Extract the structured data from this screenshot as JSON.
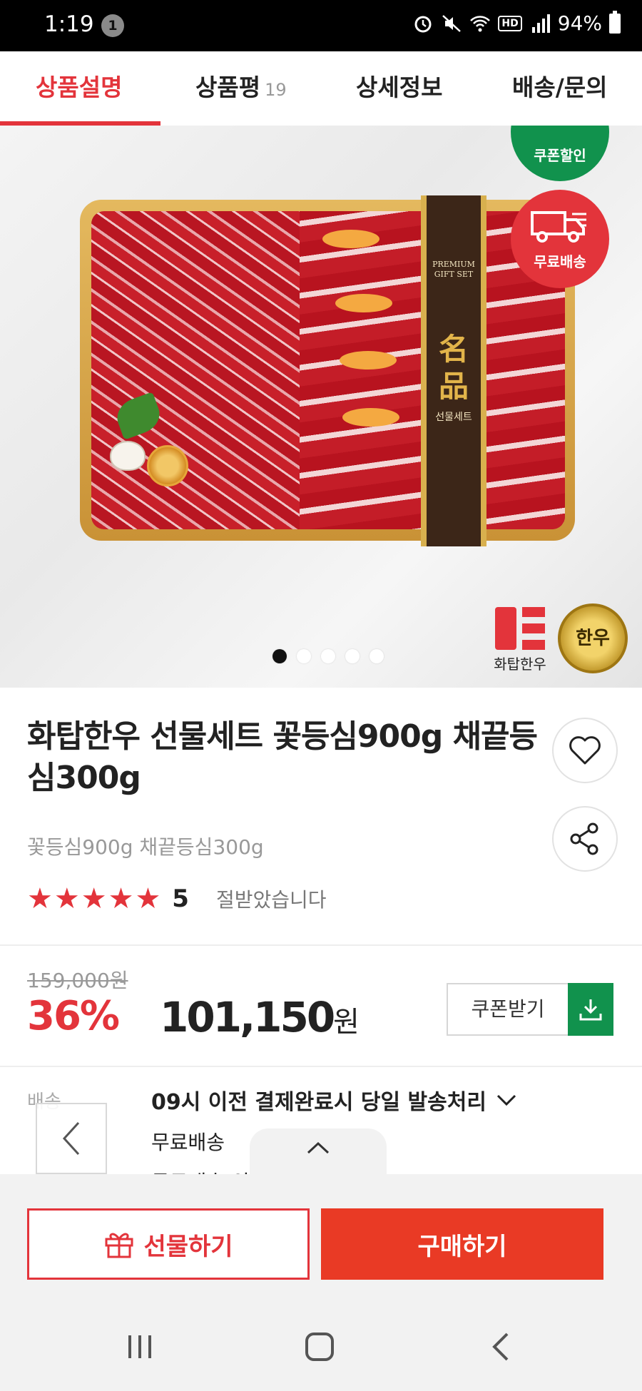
{
  "status_bar": {
    "time": "1:19",
    "notification_count": "1",
    "battery": "94%",
    "hd_label": "HD"
  },
  "tabs": [
    {
      "label": "상품설명",
      "count": ""
    },
    {
      "label": "상품평",
      "count": "19"
    },
    {
      "label": "상세정보",
      "count": ""
    },
    {
      "label": "배송/문의",
      "count": ""
    }
  ],
  "hero": {
    "package_label": "PREMIUM\nGIFT SET",
    "package_big": "名\n品",
    "package_sub": "선물세트",
    "badge_coupon": "쿠폰할인",
    "badge_shipping": "무료배송",
    "brand_name": "화탑한우",
    "seal_text": "한우",
    "slide_count": 5,
    "active_slide": 1
  },
  "product": {
    "title": "화탑한우 선물세트 꽃등심900g 채끝등심300g",
    "subtitle": "꽃등심900g 채끝등심300g",
    "rating": "5",
    "rating_stars": 5,
    "rating_text": "절받았습니다"
  },
  "price": {
    "original": "159,000원",
    "discount": "36%",
    "amount": "101,150",
    "unit": "원",
    "coupon_label": "쿠폰받기"
  },
  "shipping": {
    "label": "배송",
    "main": "09시 이전 결제완료시 당일 발송처리",
    "free": "무료배송",
    "more": "무료배송 외"
  },
  "actions": {
    "gift": "선물하기",
    "buy": "구매하기"
  },
  "colors": {
    "accent": "#e3343b",
    "buy": "#e93a25",
    "green": "#11924d"
  }
}
